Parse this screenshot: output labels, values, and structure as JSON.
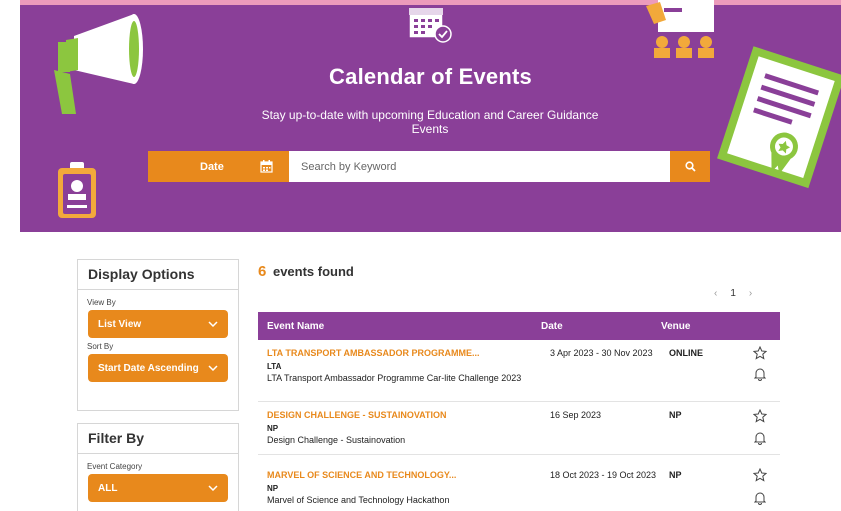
{
  "hero": {
    "title": "Calendar of Events",
    "subtitle": "Stay up-to-date with upcoming Education and Career Guidance Events"
  },
  "search": {
    "date_label": "Date",
    "placeholder": "Search by Keyword",
    "value": ""
  },
  "sidebar": {
    "display_title": "Display Options",
    "view_by_label": "View By",
    "view_by_value": "List View",
    "sort_by_label": "Sort By",
    "sort_by_value": "Start Date Ascending",
    "filter_title": "Filter By",
    "category_label": "Event Category",
    "category_value": "ALL"
  },
  "results": {
    "count": "6",
    "label": "events found",
    "page": "1"
  },
  "table": {
    "headers": {
      "name": "Event Name",
      "date": "Date",
      "venue": "Venue"
    },
    "rows": [
      {
        "title": "LTA TRANSPORT AMBASSADOR PROGRAMME...",
        "org": "LTA",
        "desc": "LTA Transport Ambassador Programme Car-lite Challenge 2023",
        "date": "3 Apr 2023 - 30 Nov 2023",
        "venue": "ONLINE"
      },
      {
        "title": "DESIGN CHALLENGE - SUSTAINOVATION",
        "org": "NP",
        "desc": "Design Challenge - Sustainovation",
        "date": "16 Sep 2023",
        "venue": "NP"
      },
      {
        "title": "MARVEL OF SCIENCE AND TECHNOLOGY...",
        "org": "NP",
        "desc": "Marvel of Science and Technology Hackathon",
        "date": "18 Oct 2023 - 19 Oct 2023",
        "venue": "NP"
      }
    ]
  },
  "colors": {
    "brand_purple": "#8a3f98",
    "accent_orange": "#e8891c",
    "light_green": "#8cc63f"
  },
  "icons": {
    "date": "calendar-icon",
    "search": "search-icon",
    "dropdown": "chevron-down-icon",
    "favorite": "star-icon",
    "reminder": "bell-icon"
  }
}
